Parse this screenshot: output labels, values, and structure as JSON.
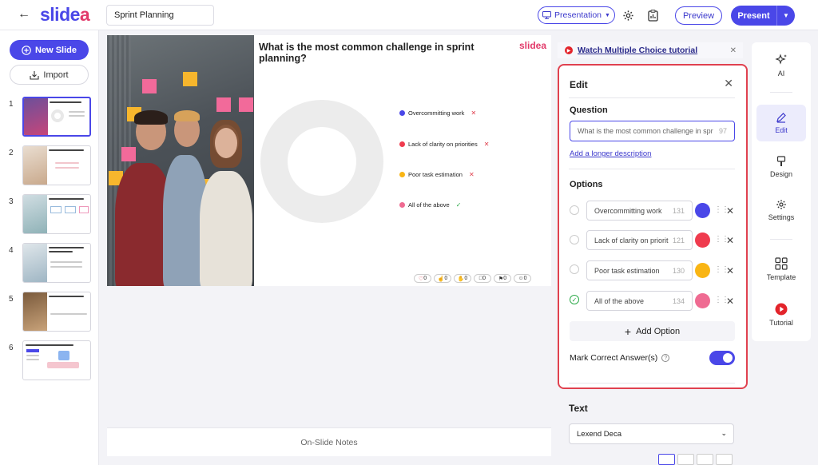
{
  "app": {
    "logo_main": "slide",
    "logo_accent": "a",
    "document_title": "Sprint Planning",
    "mode_label": "Presentation",
    "preview_label": "Preview",
    "present_label": "Present"
  },
  "sidebar": {
    "new_slide_label": "New Slide",
    "import_label": "Import",
    "slides": [
      {
        "number": "1",
        "selected": true
      },
      {
        "number": "2",
        "selected": false
      },
      {
        "number": "3",
        "selected": false
      },
      {
        "number": "4",
        "selected": false
      },
      {
        "number": "5",
        "selected": false
      },
      {
        "number": "6",
        "selected": false
      }
    ]
  },
  "slide": {
    "question": "What is the most common challenge in sprint planning?",
    "logo": "slidea",
    "legend": [
      {
        "label": "Overcommitting work",
        "color": "#4a47e8",
        "correct": false
      },
      {
        "label": "Lack of clarity on priorities",
        "color": "#ef3b4e",
        "correct": false
      },
      {
        "label": "Poor task estimation",
        "color": "#f9b514",
        "correct": false
      },
      {
        "label": "All of the above",
        "color": "#ef6b92",
        "correct": true
      }
    ],
    "reactions": [
      "0",
      "0",
      "0",
      "0",
      "0",
      "0"
    ],
    "notes_label": "On-Slide Notes"
  },
  "editor": {
    "tutorial_link": "Watch Multiple Choice tutorial",
    "title": "Edit",
    "question_label": "Question",
    "question_value": "What is the most common challenge in spr",
    "question_count": "97",
    "longer_description": "Add a longer description",
    "options_label": "Options",
    "options": [
      {
        "value": "Overcommitting work",
        "count": "131",
        "color": "#4a47e8",
        "correct": false
      },
      {
        "value": "Lack of clarity on priorit",
        "count": "121",
        "color": "#ef3b4e",
        "correct": false
      },
      {
        "value": "Poor task estimation",
        "count": "130",
        "color": "#f9b514",
        "correct": false
      },
      {
        "value": "All of the above",
        "count": "134",
        "color": "#ef6b92",
        "correct": true
      }
    ],
    "add_option_label": "Add Option",
    "mark_correct_label": "Mark Correct Answer(s)",
    "mark_correct_on": true,
    "text_label": "Text",
    "font_value": "Lexend Deca"
  },
  "rail": {
    "items": [
      {
        "label": "AI",
        "icon": "sparkle-icon",
        "active": false
      },
      {
        "label": "Edit",
        "icon": "pen-icon",
        "active": true
      },
      {
        "label": "Design",
        "icon": "brush-icon",
        "active": false
      },
      {
        "label": "Settings",
        "icon": "gear-icon",
        "active": false
      },
      {
        "label": "Template",
        "icon": "grid-icon",
        "active": false
      },
      {
        "label": "Tutorial",
        "icon": "play-icon",
        "active": false
      }
    ]
  },
  "colors": {
    "accent": "#4a47e8",
    "highlight_border": "#e0414f",
    "brand_pink": "#e23a6a"
  }
}
